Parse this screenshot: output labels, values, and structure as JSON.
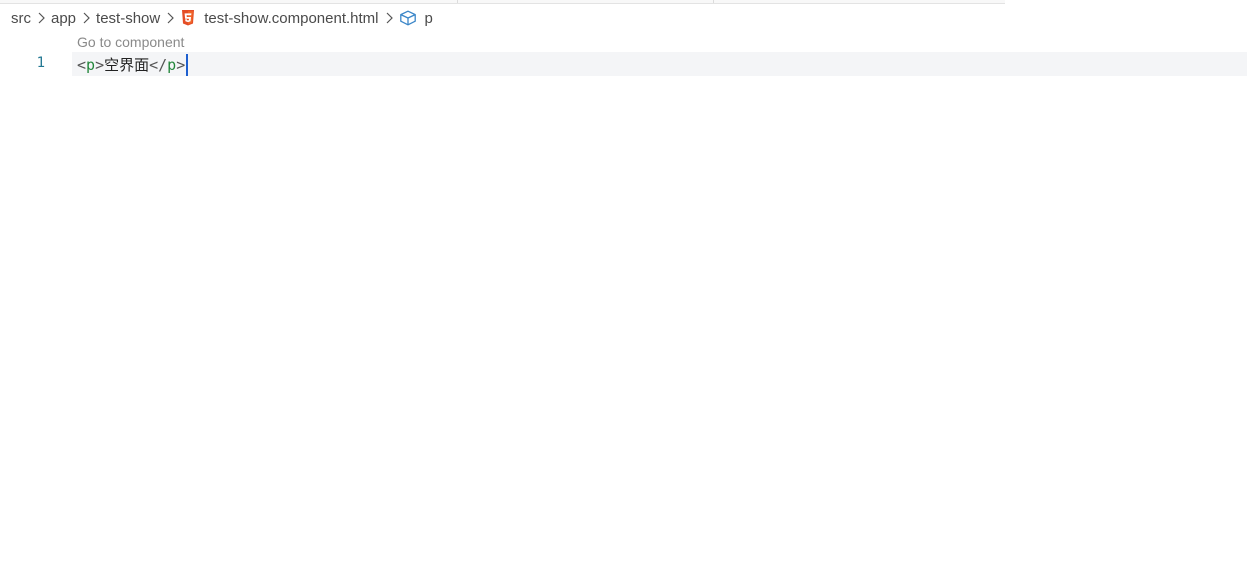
{
  "breadcrumb": {
    "items": [
      "src",
      "app",
      "test-show",
      "test-show.component.html",
      "p"
    ]
  },
  "icons": {
    "separator": "chevron-right-icon",
    "file": "html5-icon",
    "symbol": "cube-icon"
  },
  "colors": {
    "html5": "#e44d26",
    "symbol": "#3a86c8",
    "tag": "#22863a",
    "line_number": "#237893",
    "cursor": "#1e5fcf"
  },
  "editor": {
    "codelens": "Go to component",
    "line_number": "1",
    "code": {
      "open_lt": "<",
      "open_tag": "p",
      "open_gt": ">",
      "text": "空界面",
      "close_lt": "</",
      "close_tag": "p",
      "close_gt": ">"
    }
  }
}
